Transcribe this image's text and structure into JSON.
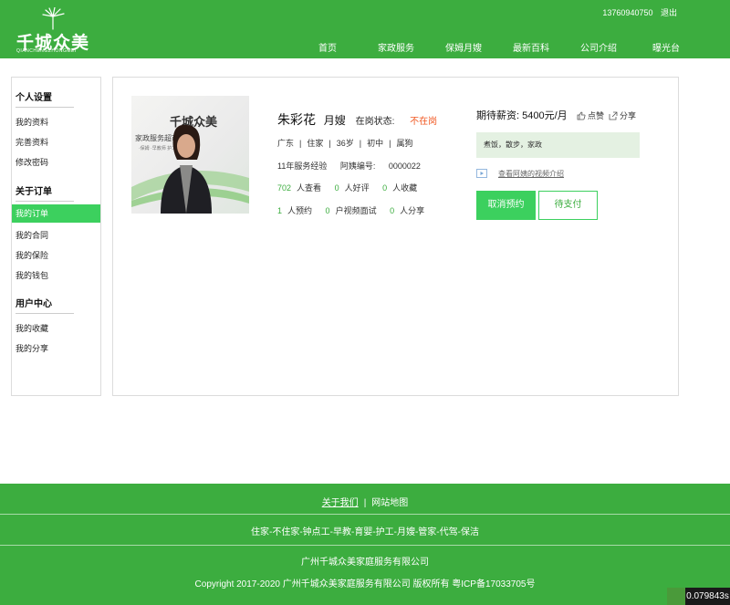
{
  "header": {
    "logo_text": "千城众美",
    "logo_sub": "QIANCHENGZHONGMEI",
    "phone": "13760940750",
    "logout": "退出",
    "nav": [
      "首页",
      "家政服务",
      "保姆月嫂",
      "最新百科",
      "公司介绍",
      "曝光台"
    ]
  },
  "sidebar": {
    "sections": [
      {
        "title": "个人设置",
        "items": [
          "我的资料",
          "完善资料",
          "修改密码"
        ]
      },
      {
        "title": "关于订单",
        "items": [
          "我的订单",
          "我的合同",
          "我的保险",
          "我的钱包"
        ]
      },
      {
        "title": "用户中心",
        "items": [
          "我的收藏",
          "我的分享"
        ]
      }
    ],
    "active_item": "我的订单"
  },
  "profile": {
    "photo": {
      "brand": "千城众美",
      "line": "家政服务超市",
      "small": "·保姆   ·早教师   护工..."
    },
    "name": "朱彩花",
    "role": "月嫂",
    "status_label": "在岗状态:",
    "status_value": "不在岗",
    "tags": [
      "广东",
      "住家",
      "36岁",
      "初中",
      "属狗"
    ],
    "experience": "11年服务经验",
    "id_label": "阿姨编号:",
    "id_value": "0000022",
    "stats": [
      {
        "num": "702",
        "label": "人查看"
      },
      {
        "num": "0",
        "label": "人好评"
      },
      {
        "num": "0",
        "label": "人收藏"
      }
    ],
    "stats2": [
      {
        "num": "1",
        "label": "人预约"
      },
      {
        "num": "0",
        "label": "户视频面试"
      },
      {
        "num": "0",
        "label": "人分享"
      }
    ],
    "salary_label": "期待薪资:",
    "salary_value": "5400元/月",
    "like_label": "点赞",
    "share_label": "分享",
    "hobbies": "煮饭，散步，家政",
    "video_link": "查看阿姨的视频介绍",
    "cancel_button": "取消预约",
    "pay_button": "待支付"
  },
  "footer": {
    "about": "关于我们",
    "sitemap": "网站地图",
    "services": "住家-不住家-钟点工-早教-育婴-护工-月嫂-管家-代驾-保洁",
    "company": "广州千城众美家庭服务有限公司",
    "copyright": "Copyright  2017-2020  广州千城众美家庭服务有限公司  版权所有  粤ICP备17033705号"
  },
  "timer": "0.079843s",
  "colors": {
    "brand_green": "#3cad3f",
    "button_green": "#3cd05e",
    "status_orange": "#f15a24",
    "hobby_bg": "#e4f1e2"
  }
}
